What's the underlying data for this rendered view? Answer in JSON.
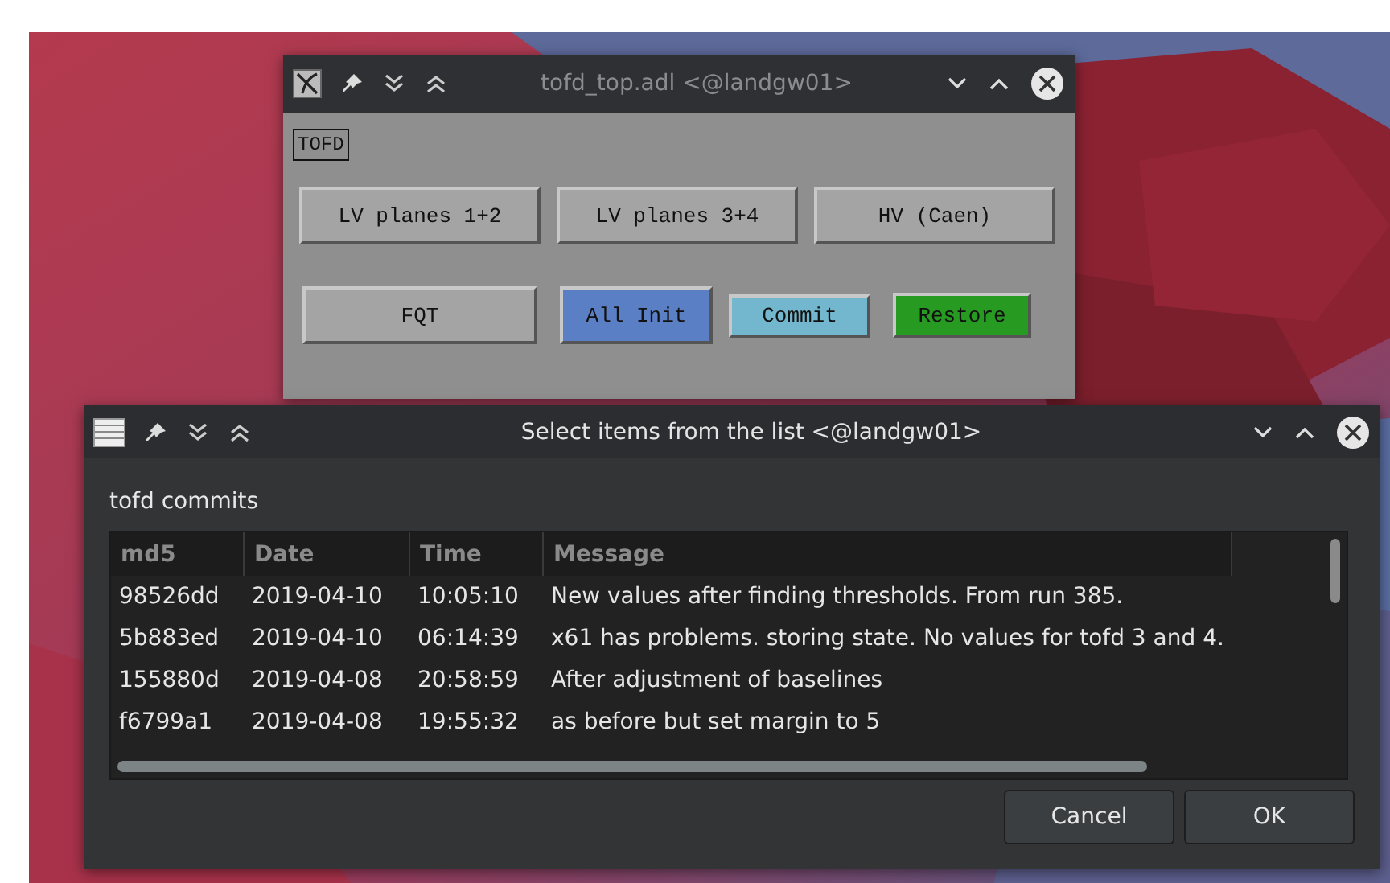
{
  "main_window": {
    "title": "tofd_top.adl <@landgw01>",
    "tag": "TOFD",
    "button_rows": [
      [
        {
          "label": "LV planes 1+2",
          "color": "#a4a4a4"
        },
        {
          "label": "LV planes 3+4",
          "color": "#a4a4a4"
        },
        {
          "label": "HV (Caen)",
          "color": "#a4a4a4"
        }
      ],
      [
        {
          "label": "FQT",
          "color": "#a4a4a4"
        },
        {
          "label": "All Init",
          "color": "#5b7fc4"
        },
        {
          "label": "Commit",
          "color": "#73b7cf"
        },
        {
          "label": "Restore",
          "color": "#279b21"
        }
      ]
    ]
  },
  "dialog": {
    "title": "Select items from the list <@landgw01>",
    "label": "tofd commits",
    "table": {
      "columns": [
        "md5",
        "Date",
        "Time",
        "Message"
      ],
      "rows": [
        [
          "98526dd",
          "2019-04-10",
          "10:05:10",
          "New values after finding thresholds. From run 385."
        ],
        [
          "5b883ed",
          "2019-04-10",
          "06:14:39",
          "x61 has problems. storing state. No values for tofd 3 and 4."
        ],
        [
          "155880d",
          "2019-04-08",
          "20:58:59",
          "After adjustment of baselines"
        ],
        [
          "f6799a1",
          "2019-04-08",
          "19:55:32",
          "as before but set margin to 5"
        ]
      ]
    },
    "buttons": [
      "Cancel",
      "OK"
    ]
  }
}
